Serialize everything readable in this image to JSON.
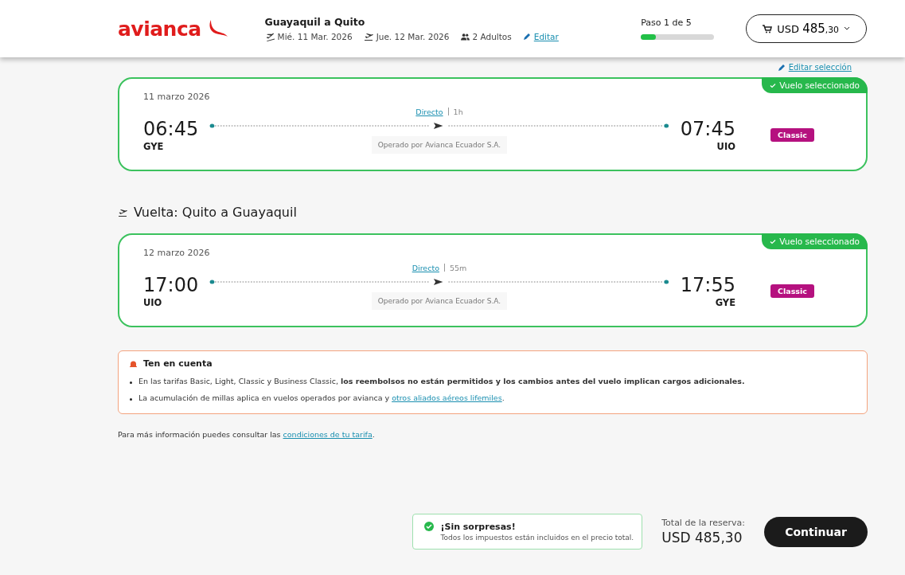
{
  "header": {
    "logo": "avianca",
    "route": "Guayaquil a Quito",
    "departure_date": "Mié. 11 Mar. 2026",
    "return_date": "Jue. 12 Mar. 2026",
    "passengers": "2 Adultos",
    "edit_link": "Editar",
    "step": {
      "label": "Paso 1 de 5",
      "level": 0.2
    },
    "cart": {
      "currency": "USD",
      "amount": "485",
      "cents": ",30"
    }
  },
  "edit_selection": "Editar selección",
  "flights": [
    {
      "badge": "Vuelo seleccionado",
      "selected": true,
      "date": "11 marzo 2026",
      "depart_time": "06:45",
      "depart_code": "GYE",
      "arrive_time": "07:45",
      "arrive_code": "UIO",
      "stops": "Directo",
      "duration": "1h",
      "operator": "Operado por Avianca Ecuador S.A.",
      "fare": "Classic"
    },
    {
      "heading": "Vuelta: Quito a Guayaquil",
      "badge": "Vuelo seleccionado",
      "selected": true,
      "date": "12 marzo 2026",
      "depart_time": "17:00",
      "depart_code": "UIO",
      "arrive_time": "17:55",
      "arrive_code": "GYE",
      "stops": "Directo",
      "duration": "55m",
      "operator": "Operado por Avianca Ecuador S.A.",
      "fare": "Classic"
    }
  ],
  "notice": {
    "title": "Ten en cuenta",
    "items": [
      {
        "kind": "text",
        "text": "En las tarifas Basic, Light, Classic y Business Classic, **los reembolsos no están permitidos y los cambios antes del vuelo implican cargos adicionales.**"
      },
      {
        "kind": "link",
        "text": "La acumulación de millas aplica en vuelos operados por avianca y ",
        "link": "otros aliados aéreos lifemiles",
        "after": "."
      }
    ]
  },
  "info": {
    "text": "Para más información puedes consultar las ",
    "link": "condiciones de tu tarifa",
    "after": "."
  },
  "footer": {
    "promise_title": "¡Sin sorpresas!",
    "promise_text": "Todos los impuestos están incluidos en el precio total.",
    "total_label": "Total de la reserva:",
    "total": "USD 485,30",
    "continue": "Continuar"
  }
}
